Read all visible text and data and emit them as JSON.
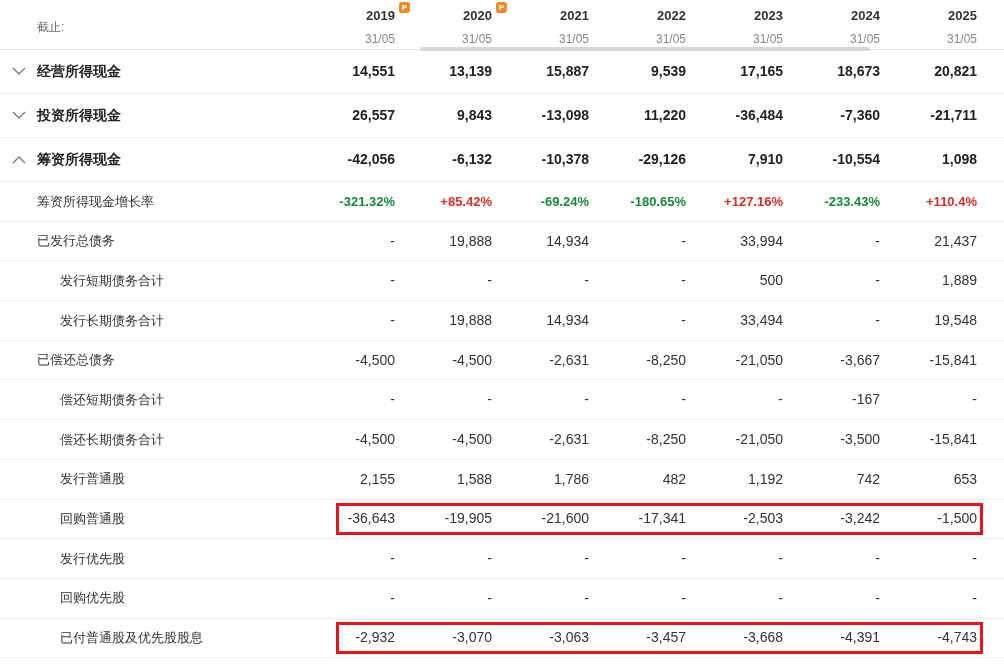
{
  "header": {
    "label": "截止:",
    "columns": [
      {
        "year": "2019",
        "date": "31/05",
        "badge": "P"
      },
      {
        "year": "2020",
        "date": "31/05",
        "badge": "P"
      },
      {
        "year": "2021",
        "date": "31/05"
      },
      {
        "year": "2022",
        "date": "31/05"
      },
      {
        "year": "2023",
        "date": "31/05"
      },
      {
        "year": "2024",
        "date": "31/05"
      },
      {
        "year": "2025",
        "date": "31/05"
      }
    ]
  },
  "rows": [
    {
      "kind": "section",
      "label": "经营所得现金",
      "expanded": false,
      "cells": [
        "14,551",
        "13,139",
        "15,887",
        "9,539",
        "17,165",
        "18,673",
        "20,821"
      ]
    },
    {
      "kind": "section",
      "label": "投资所得现金",
      "expanded": false,
      "cells": [
        "26,557",
        "9,843",
        "-13,098",
        "11,220",
        "-36,484",
        "-7,360",
        "-21,711"
      ]
    },
    {
      "kind": "section",
      "label": "筹资所得现金",
      "expanded": true,
      "cells": [
        "-42,056",
        "-6,132",
        "-10,378",
        "-29,126",
        "7,910",
        "-10,554",
        "1,098"
      ],
      "children": [
        {
          "kind": "rate",
          "label": "筹资所得现金增长率",
          "cells": [
            {
              "value": "-321.32%",
              "color": "#18893a"
            },
            {
              "value": "+85.42%",
              "color": "#d93026"
            },
            {
              "value": "-69.24%",
              "color": "#18893a"
            },
            {
              "value": "-180.65%",
              "color": "#18893a"
            },
            {
              "value": "+127.16%",
              "color": "#d93026"
            },
            {
              "value": "-233.43%",
              "color": "#18893a"
            },
            {
              "value": "+110.4%",
              "color": "#d93026"
            }
          ]
        },
        {
          "kind": "item",
          "label": "已发行总债务",
          "cells": [
            "-",
            "19,888",
            "14,934",
            "-",
            "33,994",
            "-",
            "21,437"
          ],
          "children": [
            {
              "kind": "item",
              "label": "发行短期债务合计",
              "cells": [
                "-",
                "-",
                "-",
                "-",
                "500",
                "-",
                "1,889"
              ]
            },
            {
              "kind": "item",
              "label": "发行长期债务合计",
              "cells": [
                "-",
                "19,888",
                "14,934",
                "-",
                "33,494",
                "-",
                "19,548"
              ]
            }
          ]
        },
        {
          "kind": "item",
          "label": "已偿还总债务",
          "cells": [
            "-4,500",
            "-4,500",
            "-2,631",
            "-8,250",
            "-21,050",
            "-3,667",
            "-15,841"
          ],
          "children": [
            {
              "kind": "item",
              "label": "偿还短期债务合计",
              "cells": [
                "-",
                "-",
                "-",
                "-",
                "-",
                "-167",
                "-"
              ]
            },
            {
              "kind": "item",
              "label": "偿还长期债务合计",
              "cells": [
                "-4,500",
                "-4,500",
                "-2,631",
                "-8,250",
                "-21,050",
                "-3,500",
                "-15,841"
              ]
            },
            {
              "kind": "item",
              "label": "发行普通股",
              "cells": [
                "2,155",
                "1,588",
                "1,786",
                "482",
                "1,192",
                "742",
                "653"
              ]
            },
            {
              "kind": "item",
              "label": "回购普通股",
              "highlighted": true,
              "cells": [
                "-36,643",
                "-19,905",
                "-21,600",
                "-17,341",
                "-2,503",
                "-3,242",
                "-1,500"
              ]
            },
            {
              "kind": "item",
              "label": "发行优先股",
              "cells": [
                "-",
                "-",
                "-",
                "-",
                "-",
                "-",
                "-"
              ]
            },
            {
              "kind": "item",
              "label": "回购优先股",
              "cells": [
                "-",
                "-",
                "-",
                "-",
                "-",
                "-",
                "-"
              ]
            },
            {
              "kind": "item",
              "label": "已付普通股及优先股股息",
              "highlighted": true,
              "cells": [
                "-2,932",
                "-3,070",
                "-3,063",
                "-3,457",
                "-3,668",
                "-4,391",
                "-4,743"
              ]
            }
          ]
        }
      ]
    }
  ]
}
